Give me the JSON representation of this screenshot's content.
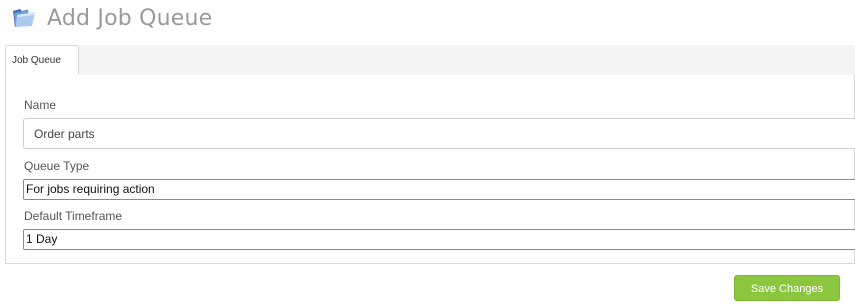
{
  "header": {
    "title": "Add Job Queue",
    "icon": "folder-icon"
  },
  "tabs": [
    {
      "label": "Job Queue",
      "active": true
    }
  ],
  "form": {
    "name": {
      "label": "Name",
      "value": "Order parts"
    },
    "queue_type": {
      "label": "Queue Type",
      "selected": "For jobs requiring action"
    },
    "default_timeframe": {
      "label": "Default Timeframe",
      "selected": "1 Day"
    }
  },
  "actions": {
    "save_label": "Save Changes"
  },
  "colors": {
    "save_button": "#8cc63f",
    "title": "#9a9a9a"
  }
}
